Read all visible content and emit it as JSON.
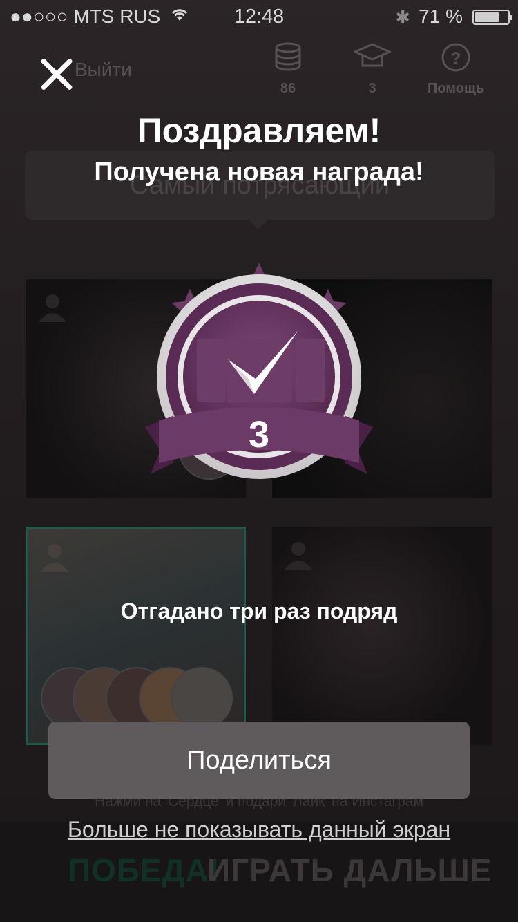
{
  "status_bar": {
    "carrier": "●●○○○ MTS RUS",
    "time": "12:48",
    "battery": "71 %"
  },
  "top_nav": {
    "exit_label": "Выйти",
    "coins": "86",
    "level": "3",
    "help_label": "Помощь"
  },
  "game": {
    "category": "Самый потрясающий",
    "like_hint": "Нажми на 'Сердце' и подари 'Лайк' на Инстаграм",
    "win_label": "ПОБЕДА!",
    "continue_label": "ИГРАТЬ ДАЛЬШЕ"
  },
  "dialog": {
    "title": "Поздравляем!",
    "subtitle": "Получена новая награда!",
    "badge_number": "3",
    "achievement": "Отгадано три раз подряд",
    "share_button": "Поделиться",
    "dont_show_link": "Больше не показывать данный экран"
  },
  "colors": {
    "badge_purple": "#6b3a66",
    "badge_ribbon": "#5e2f5a",
    "share_button_bg": "#5f5b5d",
    "win_green": "#113027"
  }
}
